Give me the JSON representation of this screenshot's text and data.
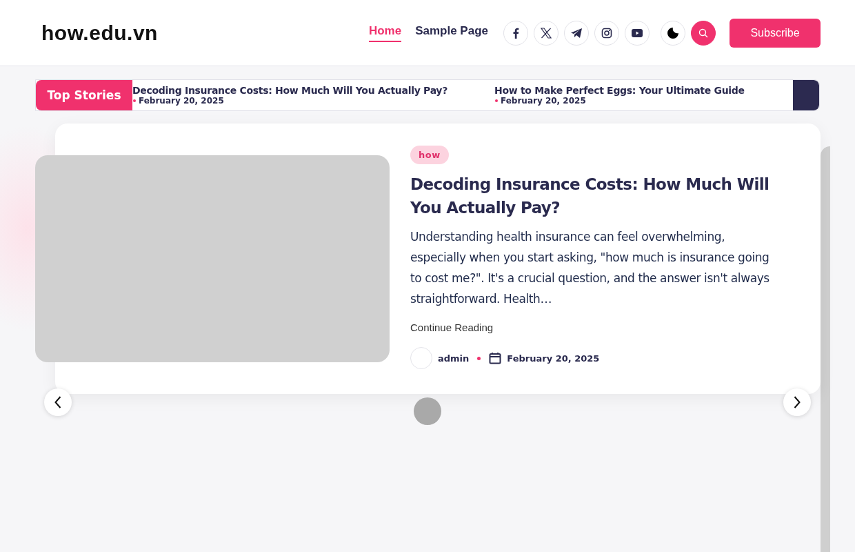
{
  "header": {
    "logo": "how.edu.vn",
    "nav": [
      {
        "label": "Home",
        "selected": true
      },
      {
        "label": "Sample Page",
        "selected": false
      }
    ],
    "social": [
      {
        "kind": "facebook"
      },
      {
        "kind": "x"
      },
      {
        "kind": "telegram"
      },
      {
        "kind": "instagram"
      },
      {
        "kind": "youtube"
      }
    ],
    "subscribe": "Subscribe"
  },
  "ticker": {
    "label": "Top Stories",
    "items": [
      {
        "title": "Decoding Insurance Costs: How Much Will You Actually Pay?",
        "date": "February 20, 2025"
      },
      {
        "title": "How to Make Perfect Eggs: Your Ultimate Guide",
        "date": "February 20, 2025"
      }
    ]
  },
  "slide": {
    "category": "how",
    "title": "Decoding Insurance Costs: How Much Will You Actually Pay?",
    "excerpt": "Understanding health insurance can feel overwhelming, especially when you start asking, \"how much is insurance going to cost me?\". It's a crucial question, and the answer isn't always straightforward. Health…",
    "link": "Continue Reading",
    "author": "admin",
    "date": "February 20, 2025"
  }
}
